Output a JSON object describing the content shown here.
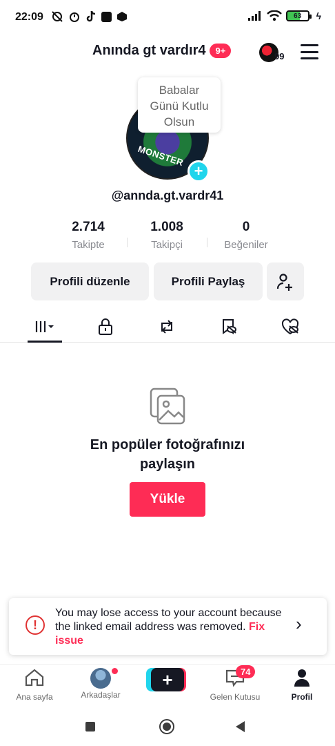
{
  "status_bar": {
    "time": "22:09",
    "battery": "63"
  },
  "header": {
    "title": "Anında gt vardır4",
    "notification_badge": "9+",
    "avatar_count": "99"
  },
  "profile": {
    "bubble_text": [
      "Babalar",
      "Günü Kutlu",
      "Olsun"
    ],
    "avatar_caption": "MONSTER",
    "username": "@annda.gt.vardr41",
    "stats": [
      {
        "value": "2.714",
        "label": "Takipte"
      },
      {
        "value": "1.008",
        "label": "Takipçi"
      },
      {
        "value": "0",
        "label": "Beğeniler"
      }
    ],
    "buttons": {
      "edit": "Profili düzenle",
      "share": "Profili Paylaş"
    }
  },
  "tabs": [
    "grid-icon",
    "lock-icon",
    "repost-icon",
    "saved-icon",
    "liked-icon"
  ],
  "empty_state": {
    "title_line1": "En popüler fotoğrafınızı",
    "title_line2": "paylaşın",
    "upload": "Yükle"
  },
  "alert": {
    "text": "You may lose access to your account because the linked email address was removed.",
    "link": "Fix issue"
  },
  "bottom_nav": {
    "items": [
      {
        "label": "Ana sayfa"
      },
      {
        "label": "Arkadaşlar"
      },
      {
        "label": ""
      },
      {
        "label": "Gelen Kutusu"
      },
      {
        "label": "Profil"
      }
    ],
    "inbox_badge": "74"
  }
}
